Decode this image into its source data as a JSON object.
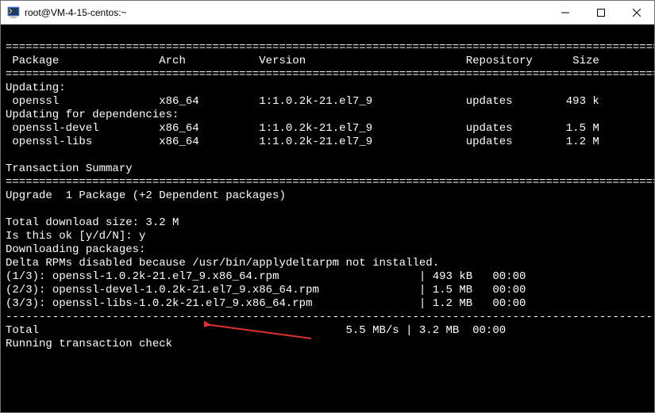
{
  "window": {
    "title": "root@VM-4-15-centos:~"
  },
  "header": {
    "col_package": "Package",
    "col_arch": "Arch",
    "col_version": "Version",
    "col_repo": "Repository",
    "col_size": "Size"
  },
  "sections": {
    "updating": "Updating:",
    "updating_deps": "Updating for dependencies:",
    "txn_summary": "Transaction Summary",
    "upgrade_line": "Upgrade  1 Package (+2 Dependent packages)",
    "total_dl": "Total download size: 3.2 M",
    "prompt": "Is this ok [y/d/N]: ",
    "prompt_answer": "y",
    "dl_packages": "Downloading packages:",
    "delta_rpms": "Delta RPMs disabled because /usr/bin/applydeltarpm not installed.",
    "total": "Total",
    "total_rate": "5.5 MB/s | 3.2 MB  00:00",
    "running_check": "Running transaction check"
  },
  "packages": [
    {
      "name": "openssl",
      "arch": "x86_64",
      "version": "1:1.0.2k-21.el7_9",
      "repo": "updates",
      "size": "493 k"
    },
    {
      "name": "openssl-devel",
      "arch": "x86_64",
      "version": "1:1.0.2k-21.el7_9",
      "repo": "updates",
      "size": "1.5 M"
    },
    {
      "name": "openssl-libs",
      "arch": "x86_64",
      "version": "1:1.0.2k-21.el7_9",
      "repo": "updates",
      "size": "1.2 M"
    }
  ],
  "downloads": [
    {
      "idx": "(1/3)",
      "file": "openssl-1.0.2k-21.el7_9.x86_64.rpm",
      "size": "493 kB",
      "time": "00:00"
    },
    {
      "idx": "(2/3)",
      "file": "openssl-devel-1.0.2k-21.el7_9.x86_64.rpm",
      "size": "1.5 MB",
      "time": "00:00"
    },
    {
      "idx": "(3/3)",
      "file": "openssl-libs-1.0.2k-21.el7_9.x86_64.rpm",
      "size": "1.2 MB",
      "time": "00:00"
    }
  ],
  "sep": {
    "eq_long": "========================================================================================================",
    "dash_long": "--------------------------------------------------------------------------------------------------------"
  }
}
